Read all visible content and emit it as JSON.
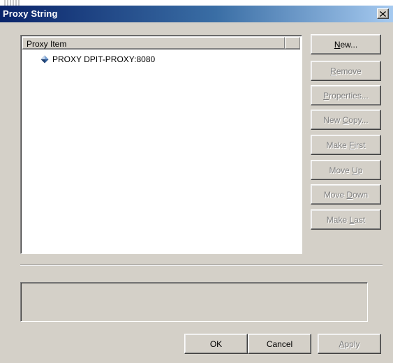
{
  "window": {
    "title": "Proxy String"
  },
  "list": {
    "columns": [
      {
        "label": "Proxy Item"
      },
      {
        "label": ""
      }
    ],
    "items": [
      {
        "label": "PROXY DPIT-PROXY:8080",
        "icon": "diamond-proxy-icon"
      }
    ]
  },
  "side_buttons": [
    {
      "id": "new-button",
      "pre": "",
      "mn": "N",
      "post": "ew...",
      "enabled": true
    },
    {
      "id": "remove-button",
      "pre": "",
      "mn": "R",
      "post": "emove",
      "enabled": false
    },
    {
      "id": "properties-button",
      "pre": "",
      "mn": "P",
      "post": "roperties...",
      "enabled": false
    },
    {
      "id": "new-copy-button",
      "pre": "New ",
      "mn": "C",
      "post": "opy...",
      "enabled": false
    },
    {
      "id": "make-first-button",
      "pre": "Make ",
      "mn": "F",
      "post": "irst",
      "enabled": false
    },
    {
      "id": "move-up-button",
      "pre": "Move ",
      "mn": "U",
      "post": "p",
      "enabled": false
    },
    {
      "id": "move-down-button",
      "pre": "Move ",
      "mn": "D",
      "post": "own",
      "enabled": false
    },
    {
      "id": "make-last-button",
      "pre": "Make ",
      "mn": "L",
      "post": "ast",
      "enabled": false
    }
  ],
  "bottom_buttons": [
    {
      "id": "ok-button",
      "pre": "OK",
      "mn": "",
      "post": "",
      "enabled": true
    },
    {
      "id": "cancel-button",
      "pre": "Cancel",
      "mn": "",
      "post": "",
      "enabled": true
    },
    {
      "id": "apply-button",
      "pre": "",
      "mn": "A",
      "post": "pply",
      "enabled": false
    }
  ],
  "colors": {
    "title_gradient_start": "#0a246a",
    "title_gradient_end": "#a6caf0",
    "dialog_face": "#d4d0c8",
    "disabled_text": "#808080"
  }
}
